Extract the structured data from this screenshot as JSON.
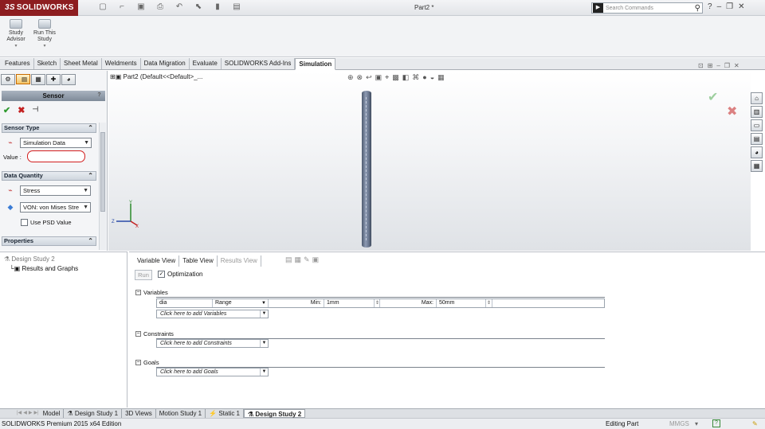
{
  "app": {
    "brand": "SOLIDWORKS",
    "brand_prefix": "3S",
    "doc_title": "Part2 *"
  },
  "search": {
    "placeholder": "Search Commands",
    "prefix": "▶"
  },
  "toolbar": {
    "study_advisor": "Study Advisor",
    "run_study": "Run This Study"
  },
  "tabs": [
    "Features",
    "Sketch",
    "Sheet Metal",
    "Weldments",
    "Data Migration",
    "Evaluate",
    "SOLIDWORKS Add-Ins",
    "Simulation"
  ],
  "active_tab": "Simulation",
  "property_manager": {
    "title": "Sensor",
    "help": "?",
    "sensor_type_header": "Sensor Type",
    "sensor_type_value": "Simulation Data",
    "value_label": "Value :",
    "data_quantity_header": "Data Quantity",
    "quantity": "Stress",
    "component": "VON: von Mises Stre",
    "use_psd": "Use PSD Value",
    "properties_header": "Properties"
  },
  "feature_tree": {
    "label": "Part2  (Default<<Default>_..."
  },
  "design_tree": {
    "root": "Design Study 2",
    "results": "Results and Graphs"
  },
  "design_study": {
    "view_tabs": [
      "Variable View",
      "Table View",
      "Results View"
    ],
    "run_label": "Run",
    "optimization_label": "Optimization",
    "variables_header": "Variables",
    "variable": {
      "name": "dia",
      "type": "Range",
      "min_label": "Min:",
      "min": "1mm",
      "max_label": "Max:",
      "max": "50mm"
    },
    "add_variables": "Click here to add Variables",
    "constraints_header": "Constraints",
    "add_constraints": "Click here to add Constraints",
    "goals_header": "Goals",
    "add_goals": "Click here to add Goals"
  },
  "bottom_tabs": [
    "Model",
    "Design Study 1",
    "3D Views",
    "Motion Study 1",
    "Static 1",
    "Design Study 2"
  ],
  "active_bottom_tab": "Design Study 2",
  "status": {
    "edition": "SOLIDWORKS Premium 2015 x64 Edition",
    "mode": "Editing Part",
    "units": "MMGS",
    "help": "?"
  },
  "colors": {
    "brand": "#8d1d20",
    "ok": "#2f9a2f",
    "cancel": "#c42020",
    "highlight": "#d21e1e"
  }
}
